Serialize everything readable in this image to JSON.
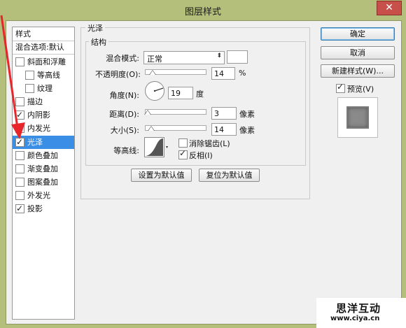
{
  "window": {
    "title": "图层样式",
    "close_glyph": "✕"
  },
  "left_panel": {
    "header_styles": "样式",
    "header_blend": "混合选项:默认",
    "items": [
      {
        "label": "斜面和浮雕",
        "checked": false
      },
      {
        "label": "等高线",
        "checked": false
      },
      {
        "label": "纹理",
        "checked": false
      },
      {
        "label": "描边",
        "checked": false
      },
      {
        "label": "内阴影",
        "checked": true
      },
      {
        "label": "内发光",
        "checked": false
      },
      {
        "label": "光泽",
        "checked": true,
        "selected": true
      },
      {
        "label": "颜色叠加",
        "checked": false
      },
      {
        "label": "渐变叠加",
        "checked": false
      },
      {
        "label": "图案叠加",
        "checked": false
      },
      {
        "label": "外发光",
        "checked": false
      },
      {
        "label": "投影",
        "checked": true
      }
    ]
  },
  "satin": {
    "group_title": "光泽",
    "structure_title": "结构",
    "blend_mode_label": "混合模式:",
    "blend_mode_value": "正常",
    "opacity_label": "不透明度(O):",
    "opacity_value": "14",
    "opacity_unit": "%",
    "angle_label": "角度(N):",
    "angle_value": "19",
    "angle_unit": "度",
    "distance_label": "距离(D):",
    "distance_value": "3",
    "distance_unit": "像素",
    "size_label": "大小(S):",
    "size_value": "14",
    "size_unit": "像素",
    "contour_label": "等高线:",
    "anti_alias_label": "消除锯齿(L)",
    "anti_alias_checked": false,
    "invert_label": "反相(I)",
    "invert_checked": true,
    "set_default_label": "设置为默认值",
    "reset_default_label": "复位为默认值"
  },
  "right_panel": {
    "ok_label": "确定",
    "cancel_label": "取消",
    "new_style_label": "新建样式(W)...",
    "preview_label": "预览(V)",
    "preview_checked": true
  },
  "watermark": {
    "name": "思洋互动",
    "url": "www.ciya.cn"
  },
  "colors": {
    "selection": "#3a8ee6",
    "titlebar": "#b3bf7a",
    "close": "#c7504a",
    "annotation_arrow": "#e8262a"
  },
  "icons": [
    "close-icon",
    "check-icon",
    "dropdown-arrow-icon",
    "slider-thumb-icon",
    "angle-dial-icon",
    "contour-curve-icon",
    "red-annotation-arrow"
  ]
}
